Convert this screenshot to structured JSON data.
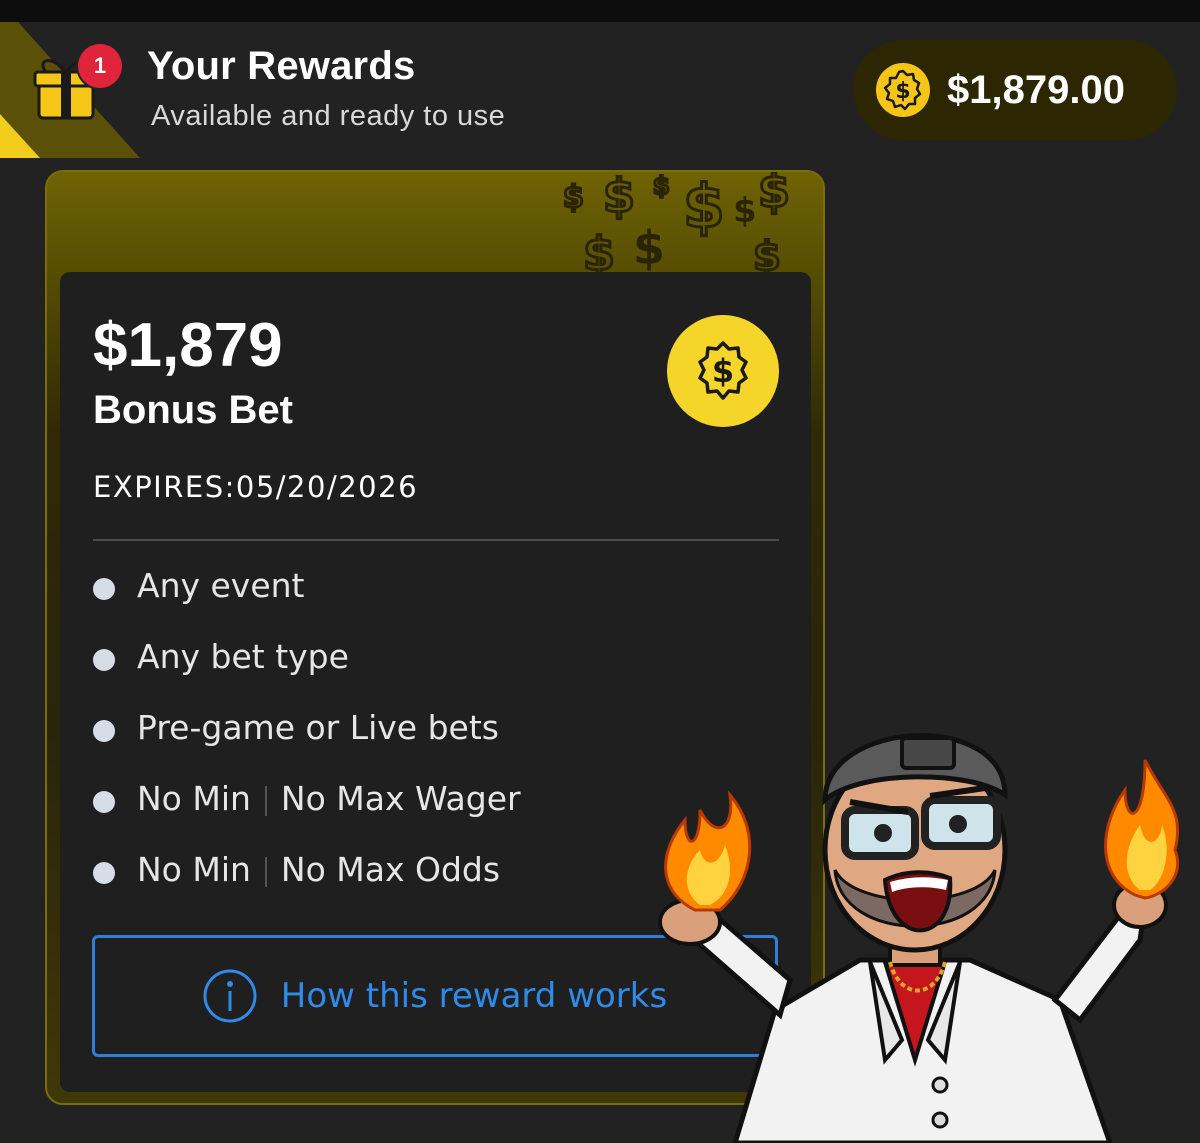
{
  "header": {
    "title": "Your Rewards",
    "subtitle": "Available and ready to use",
    "notification_count": "1",
    "gift_icon": "gift-icon"
  },
  "balance": {
    "amount": "$1,879.00",
    "coin_icon": "dollar-coin-icon"
  },
  "reward_card": {
    "amount": "$1,879",
    "type": "Bonus Bet",
    "expires": "EXPIRES:05/20/2026",
    "features": [
      {
        "text": "Any event"
      },
      {
        "text": "Any bet type"
      },
      {
        "text": "Pre-game or Live bets"
      },
      {
        "parts": [
          "No Min",
          "No Max Wager"
        ]
      },
      {
        "parts": [
          "No Min",
          "No Max Odds"
        ]
      }
    ],
    "how_button_label": "How this reward works"
  },
  "colors": {
    "background": "#222223",
    "card_inner": "#1f1f20",
    "gold_accent": "#f5d02b",
    "notification_red": "#e0243b",
    "link_blue": "#2f7fd9"
  }
}
